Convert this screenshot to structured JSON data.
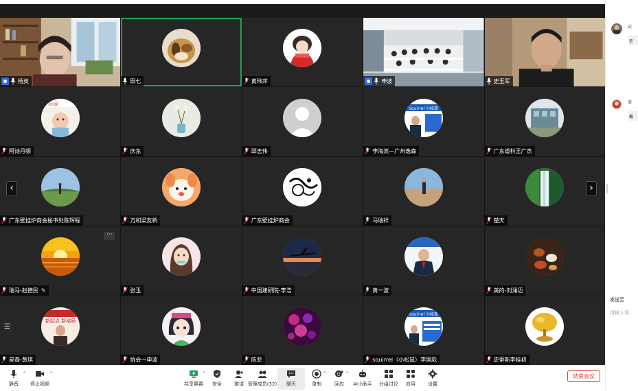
{
  "participants": [
    {
      "name": "杨英",
      "host": true,
      "mic": true,
      "video": "woman-bookshelf"
    },
    {
      "name": "田七",
      "mic": true,
      "active": true,
      "avatar": "dog"
    },
    {
      "name": "黄玮萍",
      "mic": false,
      "avatar": "red-cartoon"
    },
    {
      "name": "申波",
      "host": true,
      "mic": true,
      "video": "classroom"
    },
    {
      "name": "史玉军",
      "mic": true,
      "video": "man-office"
    },
    {
      "name": "阿诗丹顿",
      "avatar": "baby"
    },
    {
      "name": "庆东",
      "avatar": "flower-vase"
    },
    {
      "name": "邱志伟",
      "avatar": "default"
    },
    {
      "name": "李海滨—广州逸森",
      "avatar": "squirrel-banner"
    },
    {
      "name": "广东道科王广杰",
      "avatar": "building"
    },
    {
      "name": "广东壁挂炉商会秘书处陈辉程",
      "avatar": "field"
    },
    {
      "name": "万和梁友新",
      "avatar": "cartoon-face"
    },
    {
      "name": "广东壁挂炉商会",
      "avatar": "ink-art"
    },
    {
      "name": "马瑞祥",
      "avatar": "desert-man"
    },
    {
      "name": "楚天",
      "avatar": "waterfall"
    },
    {
      "name": "瑞马-赵德民",
      "avatar": "sunset",
      "more": true,
      "pencil": true
    },
    {
      "name": "张玉",
      "avatar": "girl"
    },
    {
      "name": "中国建研院-李浩",
      "avatar": "airplane"
    },
    {
      "name": "黄一波",
      "avatar": "suit-man"
    },
    {
      "name": "美的-刘涌迈",
      "avatar": "teacups"
    },
    {
      "name": "星森-黄琪",
      "avatar": "red-banner"
    },
    {
      "name": "协会～申波",
      "avatar": "cartoon-girl"
    },
    {
      "name": "陈菲",
      "avatar": "purple-flowers"
    },
    {
      "name": "squirrel（小松鼠）李国彪",
      "avatar": "squirrel-banner-2"
    },
    {
      "name": "史蒂斯李桂初",
      "avatar": "gold-tree"
    }
  ],
  "toolbar": {
    "left": [
      {
        "label": "静音",
        "icon": "mic-icon"
      },
      {
        "label": "停止视频",
        "icon": "video-camera-icon"
      }
    ],
    "center": [
      {
        "label": "共享屏幕",
        "icon": "share-screen-icon"
      },
      {
        "label": "安全",
        "icon": "shield-icon"
      },
      {
        "label": "邀请",
        "icon": "invite-icon"
      },
      {
        "label": "管理成员(32)",
        "icon": "members-icon"
      },
      {
        "label": "聊天",
        "icon": "chat-icon"
      },
      {
        "label": "录制",
        "icon": "record-icon"
      },
      {
        "label": "回应",
        "icon": "reaction-icon"
      },
      {
        "label": "AI小助手",
        "icon": "ai-assistant-icon"
      },
      {
        "label": "分组讨论",
        "icon": "breakout-icon"
      },
      {
        "label": "应用",
        "icon": "apps-icon"
      },
      {
        "label": "设置",
        "icon": "gear-icon"
      }
    ],
    "end_meeting": "结束会议"
  },
  "chat": {
    "messages": [
      {
        "sender": "史",
        "text": "史"
      },
      {
        "sender": "黄",
        "text": "截"
      }
    ],
    "send_to": "发送至",
    "input_placeholder": "请输入消"
  },
  "colors": {
    "active_speaker": "#1fa55a",
    "host_badge": "#2d6cf0",
    "end_meeting": "#e4463b",
    "tile_bg": "#262626"
  }
}
